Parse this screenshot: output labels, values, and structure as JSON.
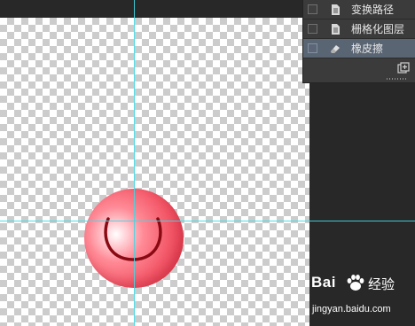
{
  "layers_panel": {
    "items": [
      {
        "label": "变换路径",
        "icon": "document-icon",
        "selected": false
      },
      {
        "label": "栅格化图层",
        "icon": "document-icon",
        "selected": false
      },
      {
        "label": "橡皮擦",
        "icon": "eraser-icon",
        "selected": true
      }
    ],
    "footer_button_icon": "new-document-icon"
  },
  "canvas": {
    "guides": [
      "vertical",
      "horizontal"
    ],
    "guide_color": "#3fd9e6",
    "object": "red-smiley-ball",
    "ball_color": "#f45b6b",
    "smile_color": "#8a0a14"
  },
  "watermark": {
    "logo": "Bai",
    "title": "经验",
    "url": "jingyan.baidu.com"
  }
}
